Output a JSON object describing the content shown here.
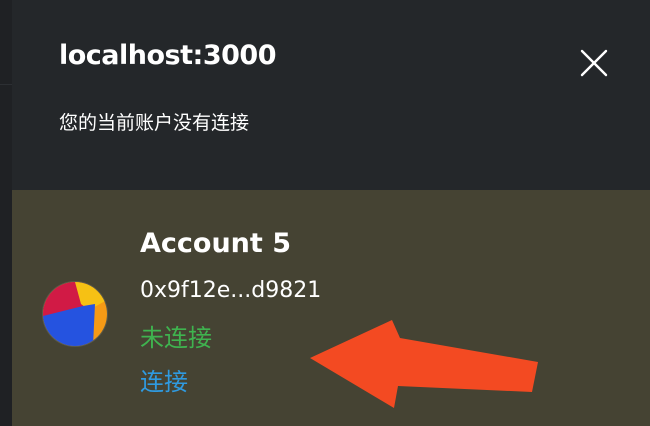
{
  "header": {
    "site": "localhost:3000",
    "status_message": "您的当前账户没有连接"
  },
  "icons": {
    "close": "close-icon",
    "avatar": "account-identicon",
    "annotation": "red-arrow-annotation"
  },
  "account": {
    "name": "Account 5",
    "address": "0x9f12e...d9821",
    "connection_status": "未连接",
    "connect_label": "连接"
  },
  "colors": {
    "background": "#24272a",
    "account_bg": "#454333",
    "status_green": "#3fb34f",
    "link_blue": "#2f9ae0",
    "arrow_red": "#f34a22"
  }
}
